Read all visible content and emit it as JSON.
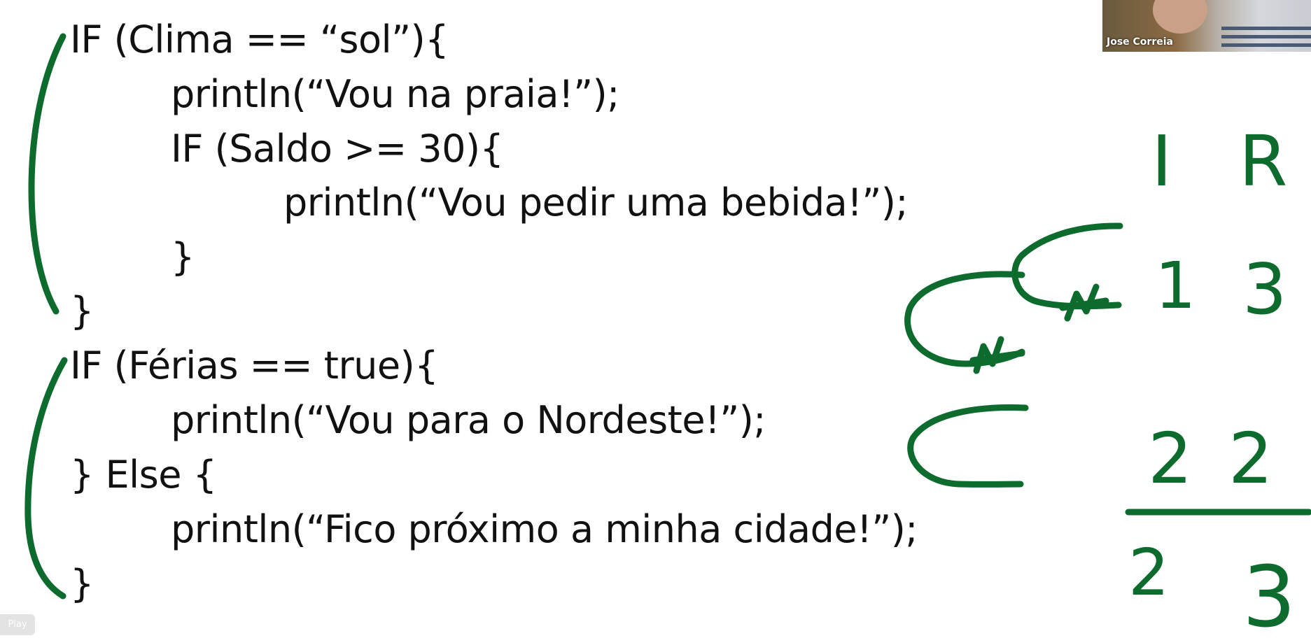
{
  "code": {
    "lines": [
      "IF (Clima == “sol”){",
      "println(“Vou na praia!”);",
      "IF (Saldo >= 30){",
      "println(“Vou pedir uma bebida!”);",
      "}",
      "}",
      "IF (Férias == true){",
      "println(“Vou para o Nordeste!”);",
      "} Else {",
      "println(“Fico próximo a minha cidade!”);",
      "}"
    ]
  },
  "annotations": {
    "header_i": "I",
    "header_r": "R",
    "row1_i": "1",
    "row1_r": "3",
    "row2_i": "2",
    "row2_r": "2",
    "row3_i": "2",
    "row3_r": "3",
    "mark_n1": "N",
    "mark_n2": "N",
    "ink_color": "#0e6b2e"
  },
  "video": {
    "participant_name": "Jose Correia"
  },
  "controls": {
    "play_label": "Play"
  }
}
